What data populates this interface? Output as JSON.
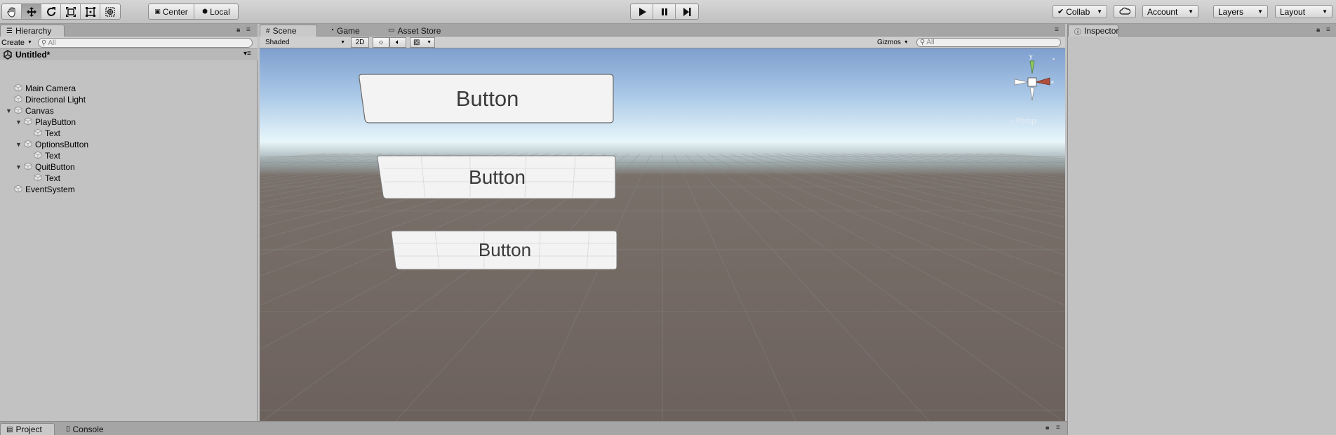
{
  "toolbar": {
    "tools": [
      "hand-icon",
      "move-icon",
      "rotate-icon",
      "scale-icon",
      "rect-icon",
      "transform-icon"
    ],
    "pivot": {
      "center_label": "Center",
      "local_label": "Local"
    },
    "playback": [
      "play-icon",
      "pause-icon",
      "step-icon"
    ],
    "collab_label": "Collab",
    "account_label": "Account",
    "layers_label": "Layers",
    "layout_label": "Layout"
  },
  "hierarchy": {
    "tab_label": "Hierarchy",
    "create_label": "Create",
    "search_placeholder": "All",
    "scene_name": "Untitled*",
    "items": [
      {
        "label": "Main Camera",
        "depth": 0,
        "foldout": false
      },
      {
        "label": "Directional Light",
        "depth": 0,
        "foldout": false
      },
      {
        "label": "Canvas",
        "depth": 0,
        "foldout": true
      },
      {
        "label": "PlayButton",
        "depth": 1,
        "foldout": true
      },
      {
        "label": "Text",
        "depth": 2,
        "foldout": false
      },
      {
        "label": "OptionsButton",
        "depth": 1,
        "foldout": true
      },
      {
        "label": "Text",
        "depth": 2,
        "foldout": false
      },
      {
        "label": "QuitButton",
        "depth": 1,
        "foldout": true
      },
      {
        "label": "Text",
        "depth": 2,
        "foldout": false
      },
      {
        "label": "EventSystem",
        "depth": 0,
        "foldout": false
      }
    ]
  },
  "scene": {
    "tabs": [
      {
        "label": "Scene",
        "icon": "grid-icon",
        "active": true
      },
      {
        "label": "Game",
        "icon": "pacman-icon",
        "active": false
      },
      {
        "label": "Asset Store",
        "icon": "store-icon",
        "active": false
      }
    ],
    "shading_mode": "Shaded",
    "mode_2d_label": "2D",
    "gizmos_label": "Gizmos",
    "search_placeholder": "All",
    "gizmo_axis_label": "y",
    "persp_label": "Persp",
    "buttons": [
      {
        "label": "Button"
      },
      {
        "label": "Button"
      },
      {
        "label": "Button"
      }
    ]
  },
  "inspector": {
    "tab_label": "Inspector"
  },
  "bottom": {
    "tabs": [
      {
        "label": "Project",
        "active": true
      },
      {
        "label": "Console",
        "active": false
      }
    ]
  }
}
